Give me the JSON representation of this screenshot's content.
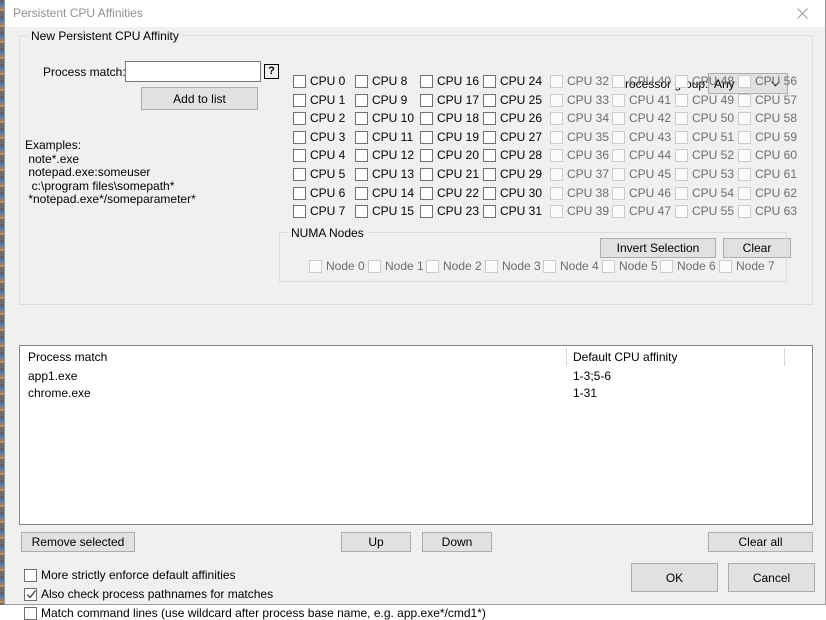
{
  "window": {
    "title": "Persistent CPU Affinities",
    "close_icon": "close-icon"
  },
  "new_affinity_group": {
    "legend": "New Persistent CPU Affinity",
    "process_match_label": "Process match:",
    "process_match_value": "",
    "process_match_placeholder": "",
    "help_button_label": "?",
    "add_to_list_label": "Add to list",
    "examples_heading": "Examples:",
    "examples": [
      "note*.exe",
      "notepad.exe:someuser",
      " c:\\program files\\somepath*",
      "*notepad.exe*/someparameter*"
    ],
    "processor_group_label": "Processor group:",
    "processor_group_value": "Any",
    "processor_group_options": [
      "Any"
    ],
    "invert_selection_label": "Invert Selection",
    "clear_label": "Clear",
    "cpu_columns": [
      {
        "enabled": true,
        "items": [
          {
            "label": "CPU 0",
            "checked": false
          },
          {
            "label": "CPU 1",
            "checked": false
          },
          {
            "label": "CPU 2",
            "checked": false
          },
          {
            "label": "CPU 3",
            "checked": false
          },
          {
            "label": "CPU 4",
            "checked": false
          },
          {
            "label": "CPU 5",
            "checked": false
          },
          {
            "label": "CPU 6",
            "checked": false
          },
          {
            "label": "CPU 7",
            "checked": false
          }
        ]
      },
      {
        "enabled": true,
        "items": [
          {
            "label": "CPU 8",
            "checked": false
          },
          {
            "label": "CPU 9",
            "checked": false
          },
          {
            "label": "CPU 10",
            "checked": false
          },
          {
            "label": "CPU 11",
            "checked": false
          },
          {
            "label": "CPU 12",
            "checked": false
          },
          {
            "label": "CPU 13",
            "checked": false
          },
          {
            "label": "CPU 14",
            "checked": false
          },
          {
            "label": "CPU 15",
            "checked": false
          }
        ]
      },
      {
        "enabled": true,
        "items": [
          {
            "label": "CPU 16",
            "checked": false
          },
          {
            "label": "CPU 17",
            "checked": false
          },
          {
            "label": "CPU 18",
            "checked": false
          },
          {
            "label": "CPU 19",
            "checked": false
          },
          {
            "label": "CPU 20",
            "checked": false
          },
          {
            "label": "CPU 21",
            "checked": false
          },
          {
            "label": "CPU 22",
            "checked": false
          },
          {
            "label": "CPU 23",
            "checked": false
          }
        ]
      },
      {
        "enabled": true,
        "items": [
          {
            "label": "CPU 24",
            "checked": false
          },
          {
            "label": "CPU 25",
            "checked": false
          },
          {
            "label": "CPU 26",
            "checked": false
          },
          {
            "label": "CPU 27",
            "checked": false
          },
          {
            "label": "CPU 28",
            "checked": false
          },
          {
            "label": "CPU 29",
            "checked": false
          },
          {
            "label": "CPU 30",
            "checked": false
          },
          {
            "label": "CPU 31",
            "checked": false
          }
        ]
      },
      {
        "enabled": false,
        "items": [
          {
            "label": "CPU 32",
            "checked": false
          },
          {
            "label": "CPU 33",
            "checked": false
          },
          {
            "label": "CPU 34",
            "checked": false
          },
          {
            "label": "CPU 35",
            "checked": false
          },
          {
            "label": "CPU 36",
            "checked": false
          },
          {
            "label": "CPU 37",
            "checked": false
          },
          {
            "label": "CPU 38",
            "checked": false
          },
          {
            "label": "CPU 39",
            "checked": false
          }
        ]
      },
      {
        "enabled": false,
        "items": [
          {
            "label": "CPU 40",
            "checked": false
          },
          {
            "label": "CPU 41",
            "checked": false
          },
          {
            "label": "CPU 42",
            "checked": false
          },
          {
            "label": "CPU 43",
            "checked": false
          },
          {
            "label": "CPU 44",
            "checked": false
          },
          {
            "label": "CPU 45",
            "checked": false
          },
          {
            "label": "CPU 46",
            "checked": false
          },
          {
            "label": "CPU 47",
            "checked": false
          }
        ]
      },
      {
        "enabled": false,
        "items": [
          {
            "label": "CPU 48",
            "checked": false
          },
          {
            "label": "CPU 49",
            "checked": false
          },
          {
            "label": "CPU 50",
            "checked": false
          },
          {
            "label": "CPU 51",
            "checked": false
          },
          {
            "label": "CPU 52",
            "checked": false
          },
          {
            "label": "CPU 53",
            "checked": false
          },
          {
            "label": "CPU 54",
            "checked": false
          },
          {
            "label": "CPU 55",
            "checked": false
          }
        ]
      },
      {
        "enabled": false,
        "items": [
          {
            "label": "CPU 56",
            "checked": false
          },
          {
            "label": "CPU 57",
            "checked": false
          },
          {
            "label": "CPU 58",
            "checked": false
          },
          {
            "label": "CPU 59",
            "checked": false
          },
          {
            "label": "CPU 60",
            "checked": false
          },
          {
            "label": "CPU 61",
            "checked": false
          },
          {
            "label": "CPU 62",
            "checked": false
          },
          {
            "label": "CPU 63",
            "checked": false
          }
        ]
      }
    ],
    "numa": {
      "legend": "NUMA Nodes",
      "nodes": [
        {
          "label": "Node 0",
          "checked": false,
          "enabled": false
        },
        {
          "label": "Node 1",
          "checked": false,
          "enabled": false
        },
        {
          "label": "Node 2",
          "checked": false,
          "enabled": false
        },
        {
          "label": "Node 3",
          "checked": false,
          "enabled": false
        },
        {
          "label": "Node 4",
          "checked": false,
          "enabled": false
        },
        {
          "label": "Node 5",
          "checked": false,
          "enabled": false
        },
        {
          "label": "Node 6",
          "checked": false,
          "enabled": false
        },
        {
          "label": "Node 7",
          "checked": false,
          "enabled": false
        }
      ]
    }
  },
  "list": {
    "columns": [
      "Process match",
      "Default CPU affinity"
    ],
    "rows": [
      {
        "process_match": "app1.exe",
        "affinity": "1-3;5-6"
      },
      {
        "process_match": "chrome.exe",
        "affinity": "1-31"
      }
    ]
  },
  "list_buttons": {
    "remove_selected": "Remove selected",
    "up": "Up",
    "down": "Down",
    "clear_all": "Clear all"
  },
  "options": [
    {
      "label": "More strictly enforce default affinities",
      "checked": false
    },
    {
      "label": "Also check process pathnames for matches",
      "checked": true
    },
    {
      "label": "Match command lines (use wildcard after process base name, e.g. app.exe*/cmd1*)",
      "checked": false
    }
  ],
  "dialog_buttons": {
    "ok": "OK",
    "cancel": "Cancel"
  }
}
